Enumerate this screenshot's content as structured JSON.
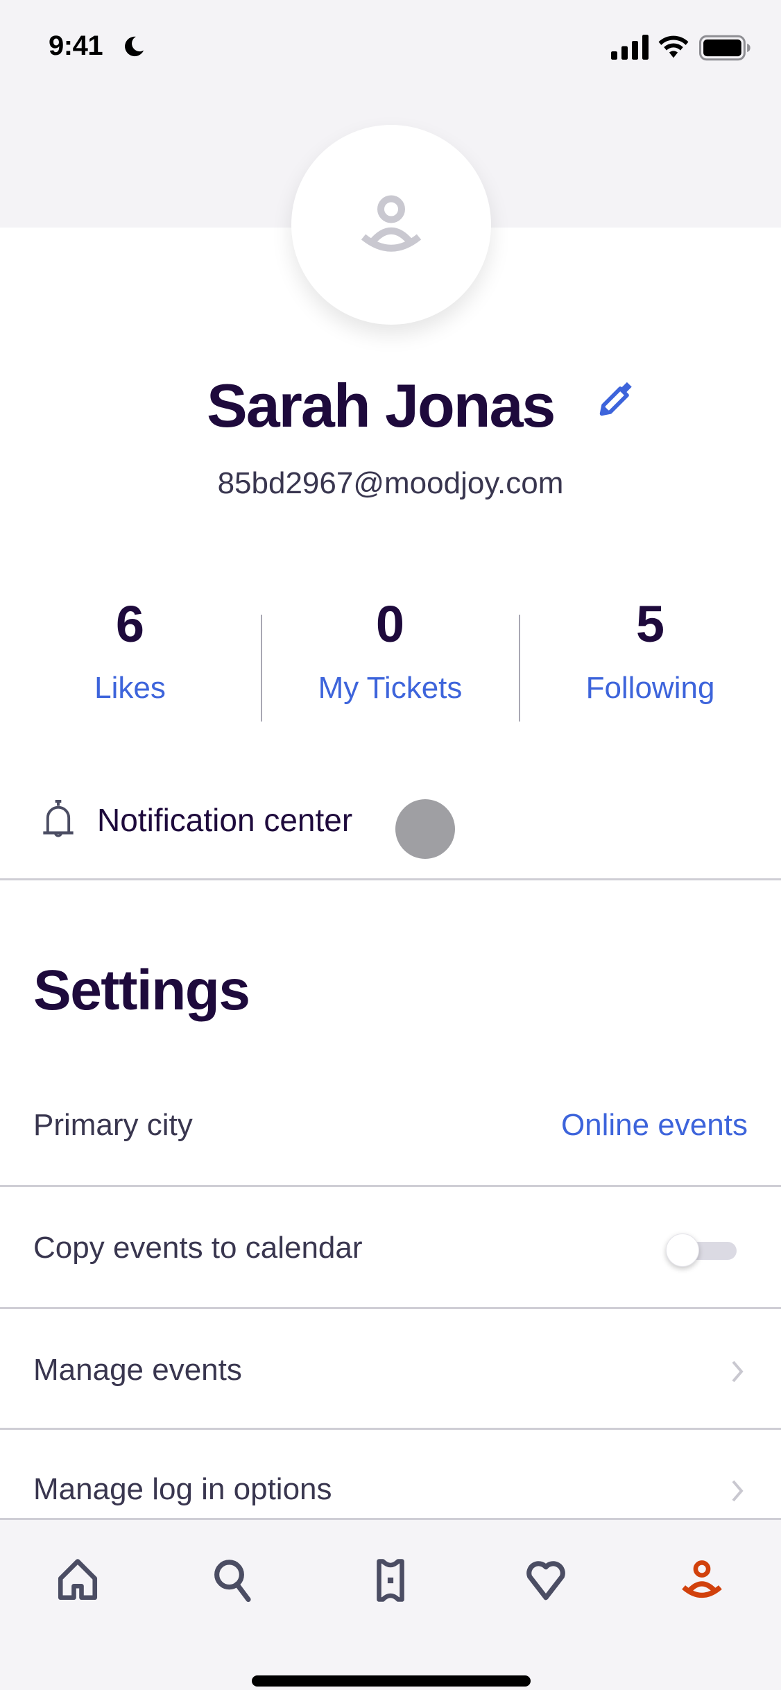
{
  "status_bar": {
    "time": "9:41",
    "icons": [
      "moon-icon",
      "cellular-signal-icon",
      "wifi-icon",
      "battery-icon"
    ]
  },
  "profile": {
    "avatar_icon": "user-placeholder-icon",
    "name": "Sarah Jonas",
    "edit_icon": "pencil-icon",
    "email": "85bd2967@moodjoy.com"
  },
  "stats": [
    {
      "value": "6",
      "label": "Likes"
    },
    {
      "value": "0",
      "label": "My Tickets"
    },
    {
      "value": "5",
      "label": "Following"
    }
  ],
  "notification_center": {
    "icon": "bell-icon",
    "label": "Notification center"
  },
  "settings": {
    "title": "Settings",
    "items": [
      {
        "label": "Primary city",
        "value": "Online events",
        "control": "link"
      },
      {
        "label": "Copy events to calendar",
        "control": "toggle",
        "toggle_on": false
      },
      {
        "label": "Manage events",
        "control": "chevron"
      },
      {
        "label": "Manage log in options",
        "control": "chevron"
      }
    ]
  },
  "tab_bar": {
    "tabs": [
      {
        "name": "home",
        "icon": "home-icon",
        "active": false
      },
      {
        "name": "search",
        "icon": "search-icon",
        "active": false
      },
      {
        "name": "tickets",
        "icon": "ticket-icon",
        "active": false
      },
      {
        "name": "likes",
        "icon": "heart-icon",
        "active": false
      },
      {
        "name": "profile",
        "icon": "profile-icon",
        "active": true
      }
    ],
    "active_color": "#d1410c",
    "inactive_color": "#4b4d63"
  },
  "colors": {
    "brand_dark": "#1e0a3c",
    "link_blue": "#3d64db",
    "accent_orange": "#d1410c"
  }
}
